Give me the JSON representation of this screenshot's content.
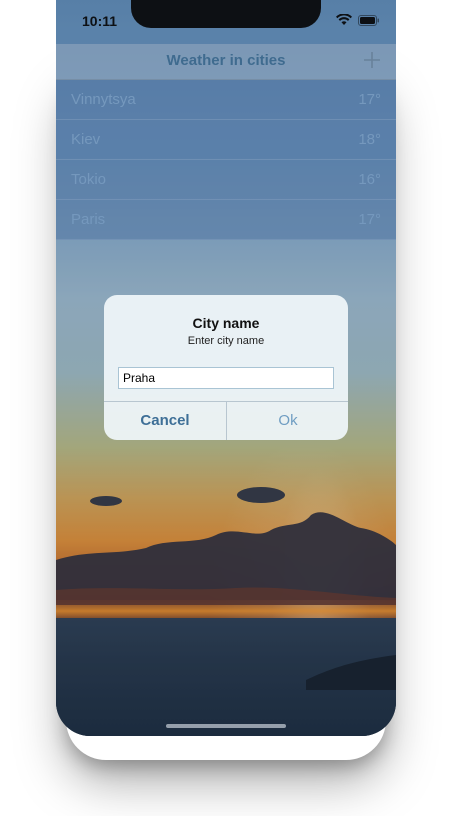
{
  "status_bar": {
    "time": "10:11"
  },
  "nav": {
    "title": "Weather in cities",
    "add_icon": "plus-icon"
  },
  "cities": [
    {
      "name": "Vinnytsya",
      "temp": "17°"
    },
    {
      "name": "Kiev",
      "temp": "18°"
    },
    {
      "name": "Tokio",
      "temp": "16°"
    },
    {
      "name": "Paris",
      "temp": "17°"
    }
  ],
  "alert": {
    "title": "City name",
    "message": "Enter city name",
    "input_value": "Praha",
    "cancel_label": "Cancel",
    "ok_label": "Ok"
  },
  "colors": {
    "accent": "#3e6f97",
    "list_text": "#7fa7cf"
  }
}
